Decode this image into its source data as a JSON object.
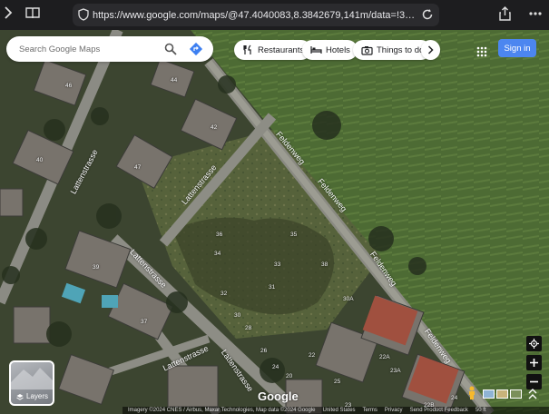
{
  "browser": {
    "url": "https://www.google.com/maps/@47.4040083,8.3842679,141m/data=!3m1!1e3?..."
  },
  "search": {
    "placeholder": "Search Google Maps"
  },
  "chips": [
    {
      "label": "Restaurants",
      "icon": "fork-knife-icon"
    },
    {
      "label": "Hotels",
      "icon": "bed-icon"
    },
    {
      "label": "Things to do",
      "icon": "camera-icon"
    }
  ],
  "header": {
    "signin": "Sign in"
  },
  "map": {
    "street_labels": [
      "Lattenstrasse",
      "Lattenstrasse",
      "Lattenstrasse",
      "Lattenstrasse",
      "Lattenstrasse",
      "Feldenweg",
      "Feldenweg",
      "Feldenweg",
      "Feldenweg"
    ],
    "house_numbers": [
      "46",
      "44",
      "42",
      "40",
      "47",
      "39",
      "37",
      "36",
      "34",
      "32",
      "30",
      "28",
      "26",
      "24",
      "22",
      "20",
      "38",
      "30A",
      "35",
      "33",
      "31",
      "25",
      "23",
      "22A",
      "23A",
      "22B",
      "24"
    ]
  },
  "layers": {
    "label": "Layers"
  },
  "attribution": {
    "google": "Google",
    "imagery": "Imagery ©2024 CNES / Airbus, Maxar Technologies, Map data ©2024 Google",
    "links": [
      "United States",
      "Terms",
      "Privacy",
      "Send Product Feedback"
    ],
    "scale": "50 ft"
  }
}
